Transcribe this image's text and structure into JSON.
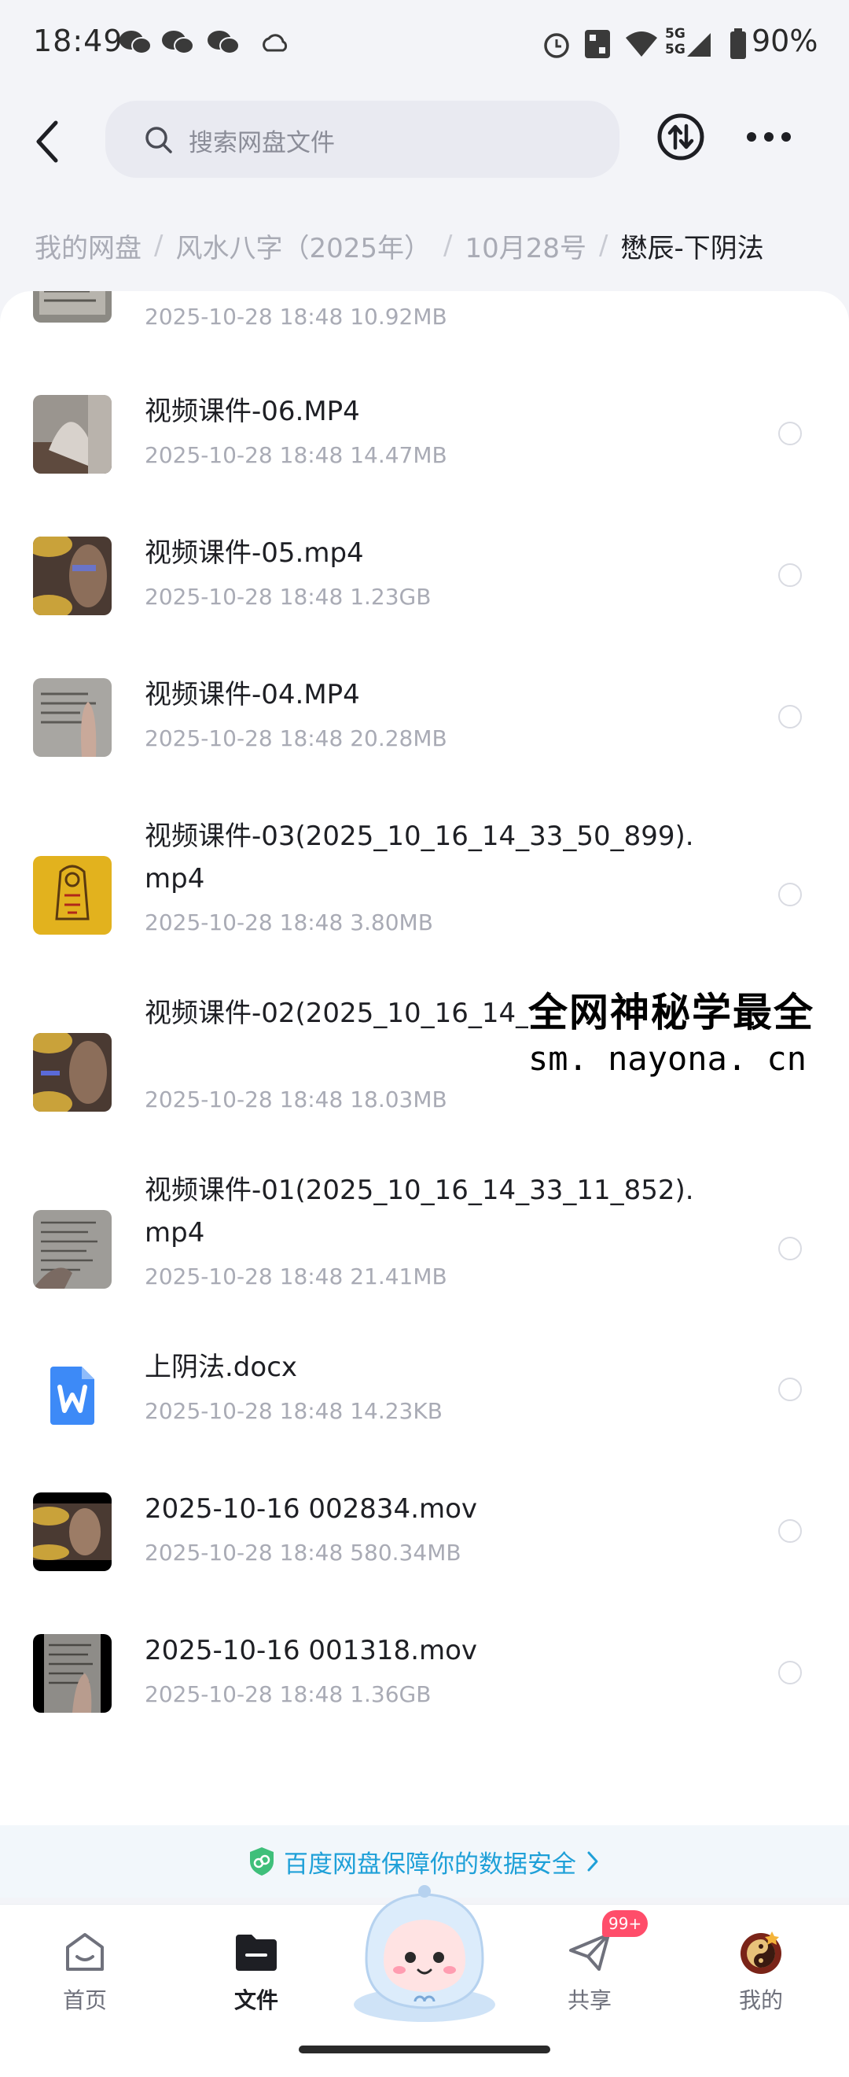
{
  "status_bar": {
    "time": "18:49",
    "signal_label": "5G\n5G",
    "battery": "90%"
  },
  "header": {
    "search_placeholder": "搜索网盘文件"
  },
  "breadcrumb": [
    {
      "label": "我的网盘"
    },
    {
      "label": "风水八字（2025年）"
    },
    {
      "label": "10月28号"
    },
    {
      "label": "懋辰-下阴法"
    }
  ],
  "files": [
    {
      "name": "",
      "meta": "2025-10-28  18:48  10.92MB",
      "thumb": "doc-photo"
    },
    {
      "name": "视频课件-06.MP4",
      "meta": "2025-10-28  18:48  14.47MB",
      "thumb": "hand-photo"
    },
    {
      "name": "视频课件-05.mp4",
      "meta": "2025-10-28  18:48  1.23GB",
      "thumb": "coins-photo"
    },
    {
      "name": "视频课件-04.MP4",
      "meta": "2025-10-28  18:48  20.28MB",
      "thumb": "paper-photo"
    },
    {
      "name": "视频课件-03(2025_10_16_14_33_50_899).mp4",
      "meta": "2025-10-28  18:48  3.80MB",
      "thumb": "yellow-talisman"
    },
    {
      "name": "视频课件-02(2025_10_16_14_33_30",
      "meta": "2025-10-28  18:48  18.03MB",
      "thumb": "coins-photo"
    },
    {
      "name": "视频课件-01(2025_10_16_14_33_11_852).mp4",
      "meta": "2025-10-28  18:48  21.41MB",
      "thumb": "paper-photo"
    },
    {
      "name": "上阴法.docx",
      "meta": "2025-10-28  18:48  14.23KB",
      "thumb": "word-doc"
    },
    {
      "name": "2025-10-16 002834.mov",
      "meta": "2025-10-28  18:48  580.34MB",
      "thumb": "coins-dark"
    },
    {
      "name": "2025-10-16 001318.mov",
      "meta": "2025-10-28  18:48  1.36GB",
      "thumb": "paper-dark"
    }
  ],
  "watermark": {
    "title": "全网神秘学最全",
    "url": "sm. nayona. cn"
  },
  "security_banner": {
    "text": "百度网盘保障你的数据安全"
  },
  "nav": {
    "home": "首页",
    "files": "文件",
    "share": "共享",
    "share_badge": "99+",
    "mine": "我的"
  },
  "colors": {
    "accent": "#1fa0d8",
    "badge": "#ff4d6a",
    "text_primary": "#1e1f24",
    "text_secondary": "#a9abb5"
  }
}
